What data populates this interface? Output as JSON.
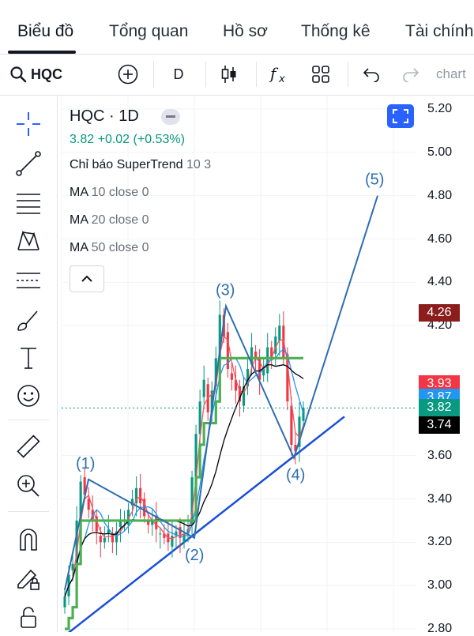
{
  "tabs": [
    {
      "label": "Biểu đồ",
      "active": true
    },
    {
      "label": "Tổng quan",
      "active": false
    },
    {
      "label": "Hồ sơ",
      "active": false
    },
    {
      "label": "Thống kê",
      "active": false
    },
    {
      "label": "Tài chính",
      "active": false
    }
  ],
  "toolbar": {
    "symbol": "HQC",
    "interval": "D",
    "undo_icon": "undo-icon",
    "redo_icon": "redo-icon",
    "chart_label": "chart"
  },
  "sidebar": {
    "icons": [
      "crosshair-icon",
      "trend-line-icon",
      "fib-lines-icon",
      "pattern-icon",
      "projection-icon",
      "brush-icon",
      "text-icon",
      "emoji-icon",
      "ruler-icon",
      "zoom-in-icon",
      "magnet-icon",
      "lock-pencil-icon",
      "lock-icon"
    ]
  },
  "legend": {
    "title": "HQC · 1D",
    "price": "3.82",
    "change": "+0.02 (+0.53%)",
    "indicators": [
      {
        "name": "Chỉ báo SuperTrend",
        "params": "10 3"
      },
      {
        "name": "MA",
        "params": "10 close 0"
      },
      {
        "name": "MA",
        "params": "20 close 0"
      },
      {
        "name": "MA",
        "params": "50 close 0"
      }
    ]
  },
  "colors": {
    "up": "#089981",
    "down": "#f23645",
    "accent": "#2962ff",
    "supertrend": "#4caf50",
    "wave": "#2e6db0"
  },
  "chart_data": {
    "type": "candlestick",
    "symbol": "HQC",
    "interval": "1D",
    "ylim": [
      2.8,
      5.2
    ],
    "y_ticks": [
      "5.20",
      "5.00",
      "4.80",
      "4.60",
      "4.40",
      "4.20",
      "3.60",
      "3.40",
      "3.20",
      "3.00",
      "2.80"
    ],
    "price_labels": [
      {
        "value": "4.26",
        "color": "#8c1d1d"
      },
      {
        "value": "3.93",
        "color": "#f23645"
      },
      {
        "value": "3.87",
        "color": "#2196f3"
      },
      {
        "value": "3.82",
        "color": "#089981"
      },
      {
        "value": "3.74",
        "color": "#000000"
      }
    ],
    "last_price": 3.82,
    "close_series": [
      2.95,
      3.05,
      3.1,
      3.3,
      3.48,
      3.42,
      3.35,
      3.3,
      3.25,
      3.2,
      3.22,
      3.26,
      3.2,
      3.25,
      3.3,
      3.28,
      3.35,
      3.4,
      3.45,
      3.38,
      3.32,
      3.28,
      3.3,
      3.26,
      3.24,
      3.22,
      3.2,
      3.23,
      3.25,
      3.22,
      3.24,
      3.26,
      3.5,
      3.7,
      3.85,
      3.95,
      3.8,
      3.9,
      4.05,
      4.25,
      4.15,
      4.0,
      3.95,
      3.9,
      3.85,
      3.92,
      4.0,
      4.1,
      4.05,
      3.95,
      4.0,
      4.1,
      4.05,
      4.15,
      4.2,
      4.05,
      3.85,
      3.65,
      3.62,
      3.78,
      3.82
    ],
    "wave_labels": [
      {
        "label": "(1)",
        "value": 3.49
      },
      {
        "label": "(2)",
        "value": 3.22
      },
      {
        "label": "(3)",
        "value": 4.29
      },
      {
        "label": "(4)",
        "value": 3.59
      },
      {
        "label": "(5)",
        "value": 4.8
      }
    ]
  }
}
